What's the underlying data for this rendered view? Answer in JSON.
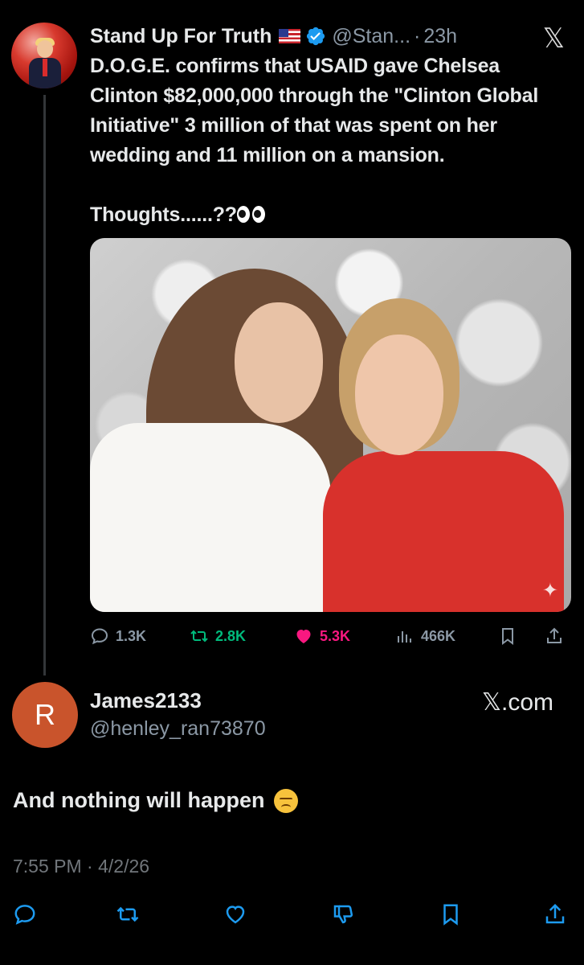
{
  "tweet": {
    "author_name": "Stand Up For Truth",
    "handle": "@Stan...",
    "separator": "·",
    "time": "23h",
    "x_logo": "𝕏",
    "text": "D.O.G.E. confirms that USAID gave Chelsea Clinton $82,000,000 through the \"Clinton Global Initiative\" 3 million of that was spent on her wedding and 11 million on a mansion.",
    "text2": "Thoughts......??",
    "image_icon": "sparkle-icon",
    "stats": {
      "replies": "1.3K",
      "reposts": "2.8K",
      "likes": "5.3K",
      "views": "466K"
    }
  },
  "reply": {
    "avatar_letter": "R",
    "name": "James2133",
    "handle": "@henley_ran73870",
    "site": "𝕏.com",
    "text": "And nothing will happen",
    "timestamp": "7:55 PM · 4/2/26"
  },
  "colors": {
    "background": "#000000",
    "text": "#e7e9ea",
    "muted": "#8b98a5",
    "repost": "#00ba7c",
    "like": "#f91880",
    "verified": "#1d9bf0"
  }
}
